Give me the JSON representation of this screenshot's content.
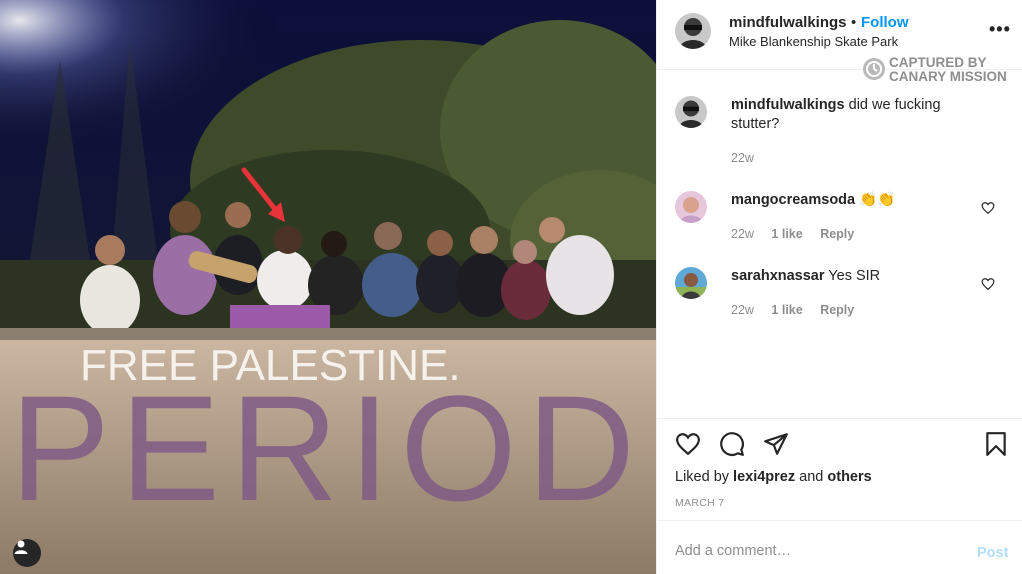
{
  "header": {
    "username": "mindfulwalkings",
    "separator": "•",
    "follow_label": "Follow",
    "location": "Mike Blankenship Skate Park",
    "more_label": "•••"
  },
  "watermark": {
    "line1": "CAPTURED BY",
    "line2": "CANARY MISSION"
  },
  "photo": {
    "chalk_text": "FREE PALESTINE.",
    "spray_text": "PERIOD"
  },
  "caption": {
    "username": "mindfulwalkings",
    "text": "did we fucking stutter?",
    "time": "22w"
  },
  "comments": [
    {
      "username": "mangocreamsoda",
      "text": "👏👏",
      "time": "22w",
      "likes": "1 like",
      "reply": "Reply"
    },
    {
      "username": "sarahxnassar",
      "text": "Yes SIR",
      "time": "22w",
      "likes": "1 like",
      "reply": "Reply"
    }
  ],
  "likes": {
    "prefix": "Liked by",
    "user": "lexi4prez",
    "joiner": "and",
    "others": "others"
  },
  "post_date": "MARCH 7",
  "add_comment": {
    "placeholder": "Add a comment…",
    "post_label": "Post"
  },
  "colors": {
    "follow": "#0095f6",
    "post_disabled": "#b2dffc",
    "muted": "#8e8e8e"
  }
}
